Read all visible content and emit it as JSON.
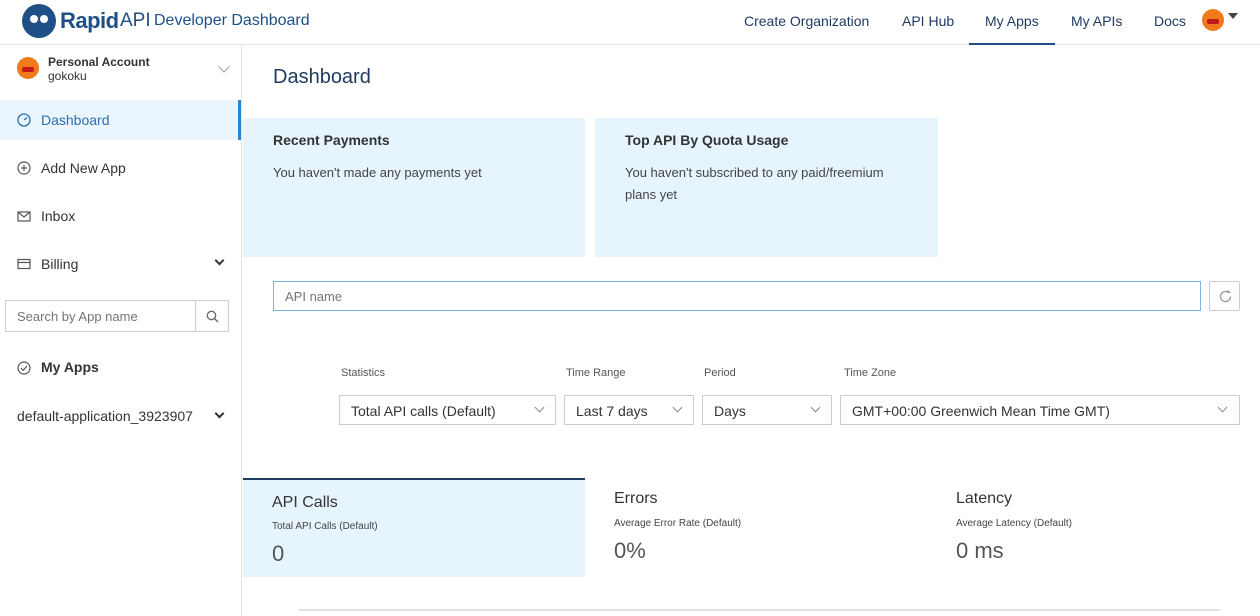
{
  "header": {
    "brand_rapid": "Rapid",
    "brand_api": "API",
    "title": "Developer Dashboard",
    "nav": [
      "Create Organization",
      "API Hub",
      "My Apps",
      "My APIs",
      "Docs"
    ],
    "active_nav": "My Apps"
  },
  "sidebar": {
    "account_type": "Personal Account",
    "username": "gokoku",
    "items": [
      {
        "label": "Dashboard",
        "icon": "gauge-icon"
      },
      {
        "label": "Add New App",
        "icon": "plus-circle-icon"
      },
      {
        "label": "Inbox",
        "icon": "envelope-icon"
      },
      {
        "label": "Billing",
        "icon": "credit-card-icon"
      }
    ],
    "search_placeholder": "Search by App name",
    "my_apps_label": "My Apps",
    "app_name": "default-application_3923907"
  },
  "main": {
    "title": "Dashboard",
    "cards": [
      {
        "title": "Recent Payments",
        "text": "You haven't made any payments yet"
      },
      {
        "title": "Top API By Quota Usage",
        "text": "You haven't subscribed to any paid/freemium plans yet"
      }
    ],
    "api_placeholder": "API name",
    "filters": {
      "statistics": {
        "label": "Statistics",
        "value": "Total API calls (Default)"
      },
      "time_range": {
        "label": "Time Range",
        "value": "Last 7 days"
      },
      "period": {
        "label": "Period",
        "value": "Days"
      },
      "time_zone": {
        "label": "Time Zone",
        "value": "GMT+00:00 Greenwich Mean Time GMT)"
      }
    },
    "stats": [
      {
        "title": "API Calls",
        "subtitle": "Total API Calls (Default)",
        "value": "0"
      },
      {
        "title": "Errors",
        "subtitle": "Average Error Rate (Default)",
        "value": "0%"
      },
      {
        "title": "Latency",
        "subtitle": "Average Latency (Default)",
        "value": "0 ms"
      }
    ]
  },
  "colors": {
    "brand": "#1e4f86",
    "accent": "#2b86d1",
    "card_bg": "#e6f5fd",
    "avatar": "#f07a1a"
  }
}
